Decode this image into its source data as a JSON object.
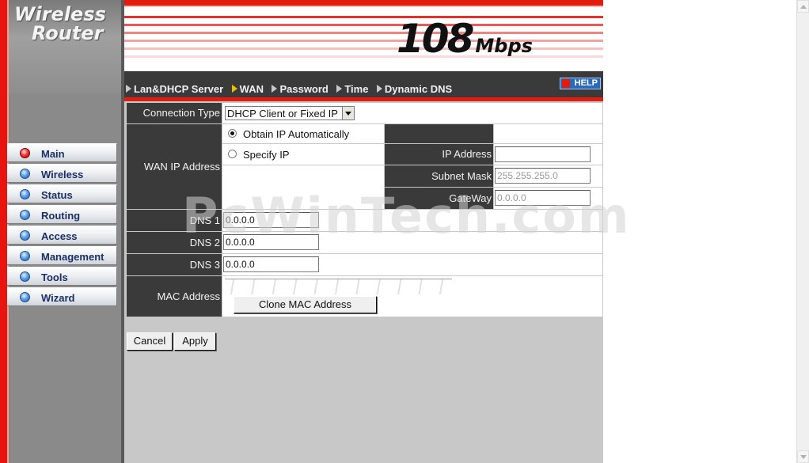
{
  "logo": {
    "line1": "Wireless",
    "line2": "Router"
  },
  "banner": {
    "speed_number": "108",
    "speed_unit": "Mbps"
  },
  "colors": {
    "accent_red": "#e31c10",
    "nav_bg": "#3a3a3a",
    "menu_text": "#1a2f66"
  },
  "nav": {
    "tabs": [
      {
        "label": "Lan&DHCP Server",
        "active": false
      },
      {
        "label": "WAN",
        "active": true
      },
      {
        "label": "Password",
        "active": false
      },
      {
        "label": "Time",
        "active": false
      },
      {
        "label": "Dynamic DNS",
        "active": false
      }
    ],
    "help_label": "HELP"
  },
  "menu": {
    "items": [
      {
        "label": "Main",
        "active": true
      },
      {
        "label": "Wireless",
        "active": false
      },
      {
        "label": "Status",
        "active": false
      },
      {
        "label": "Routing",
        "active": false
      },
      {
        "label": "Access",
        "active": false
      },
      {
        "label": "Management",
        "active": false
      },
      {
        "label": "Tools",
        "active": false
      },
      {
        "label": "Wizard",
        "active": false
      }
    ]
  },
  "form": {
    "connection_type": {
      "label": "Connection Type",
      "value": "DHCP Client or Fixed IP"
    },
    "wan_ip": {
      "label": "WAN IP Address",
      "obtain_auto": "Obtain IP Automatically",
      "specify": "Specify IP",
      "selected": "obtain_auto",
      "ip_label": "IP Address",
      "ip_value": "",
      "mask_label": "Subnet Mask",
      "mask_value": "255.255.255.0",
      "gateway_label": "GateWay",
      "gateway_value": "0.0.0.0"
    },
    "dns1": {
      "label": "DNS 1",
      "value": "0.0.0.0"
    },
    "dns2": {
      "label": "DNS 2",
      "value": "0.0.0.0"
    },
    "dns3": {
      "label": "DNS 3",
      "value": "0.0.0.0"
    },
    "mac": {
      "label": "MAC Address",
      "clone_label": "Clone MAC Address"
    }
  },
  "buttons": {
    "cancel": "Cancel",
    "apply": "Apply"
  },
  "watermark": "PcWinTech.com"
}
